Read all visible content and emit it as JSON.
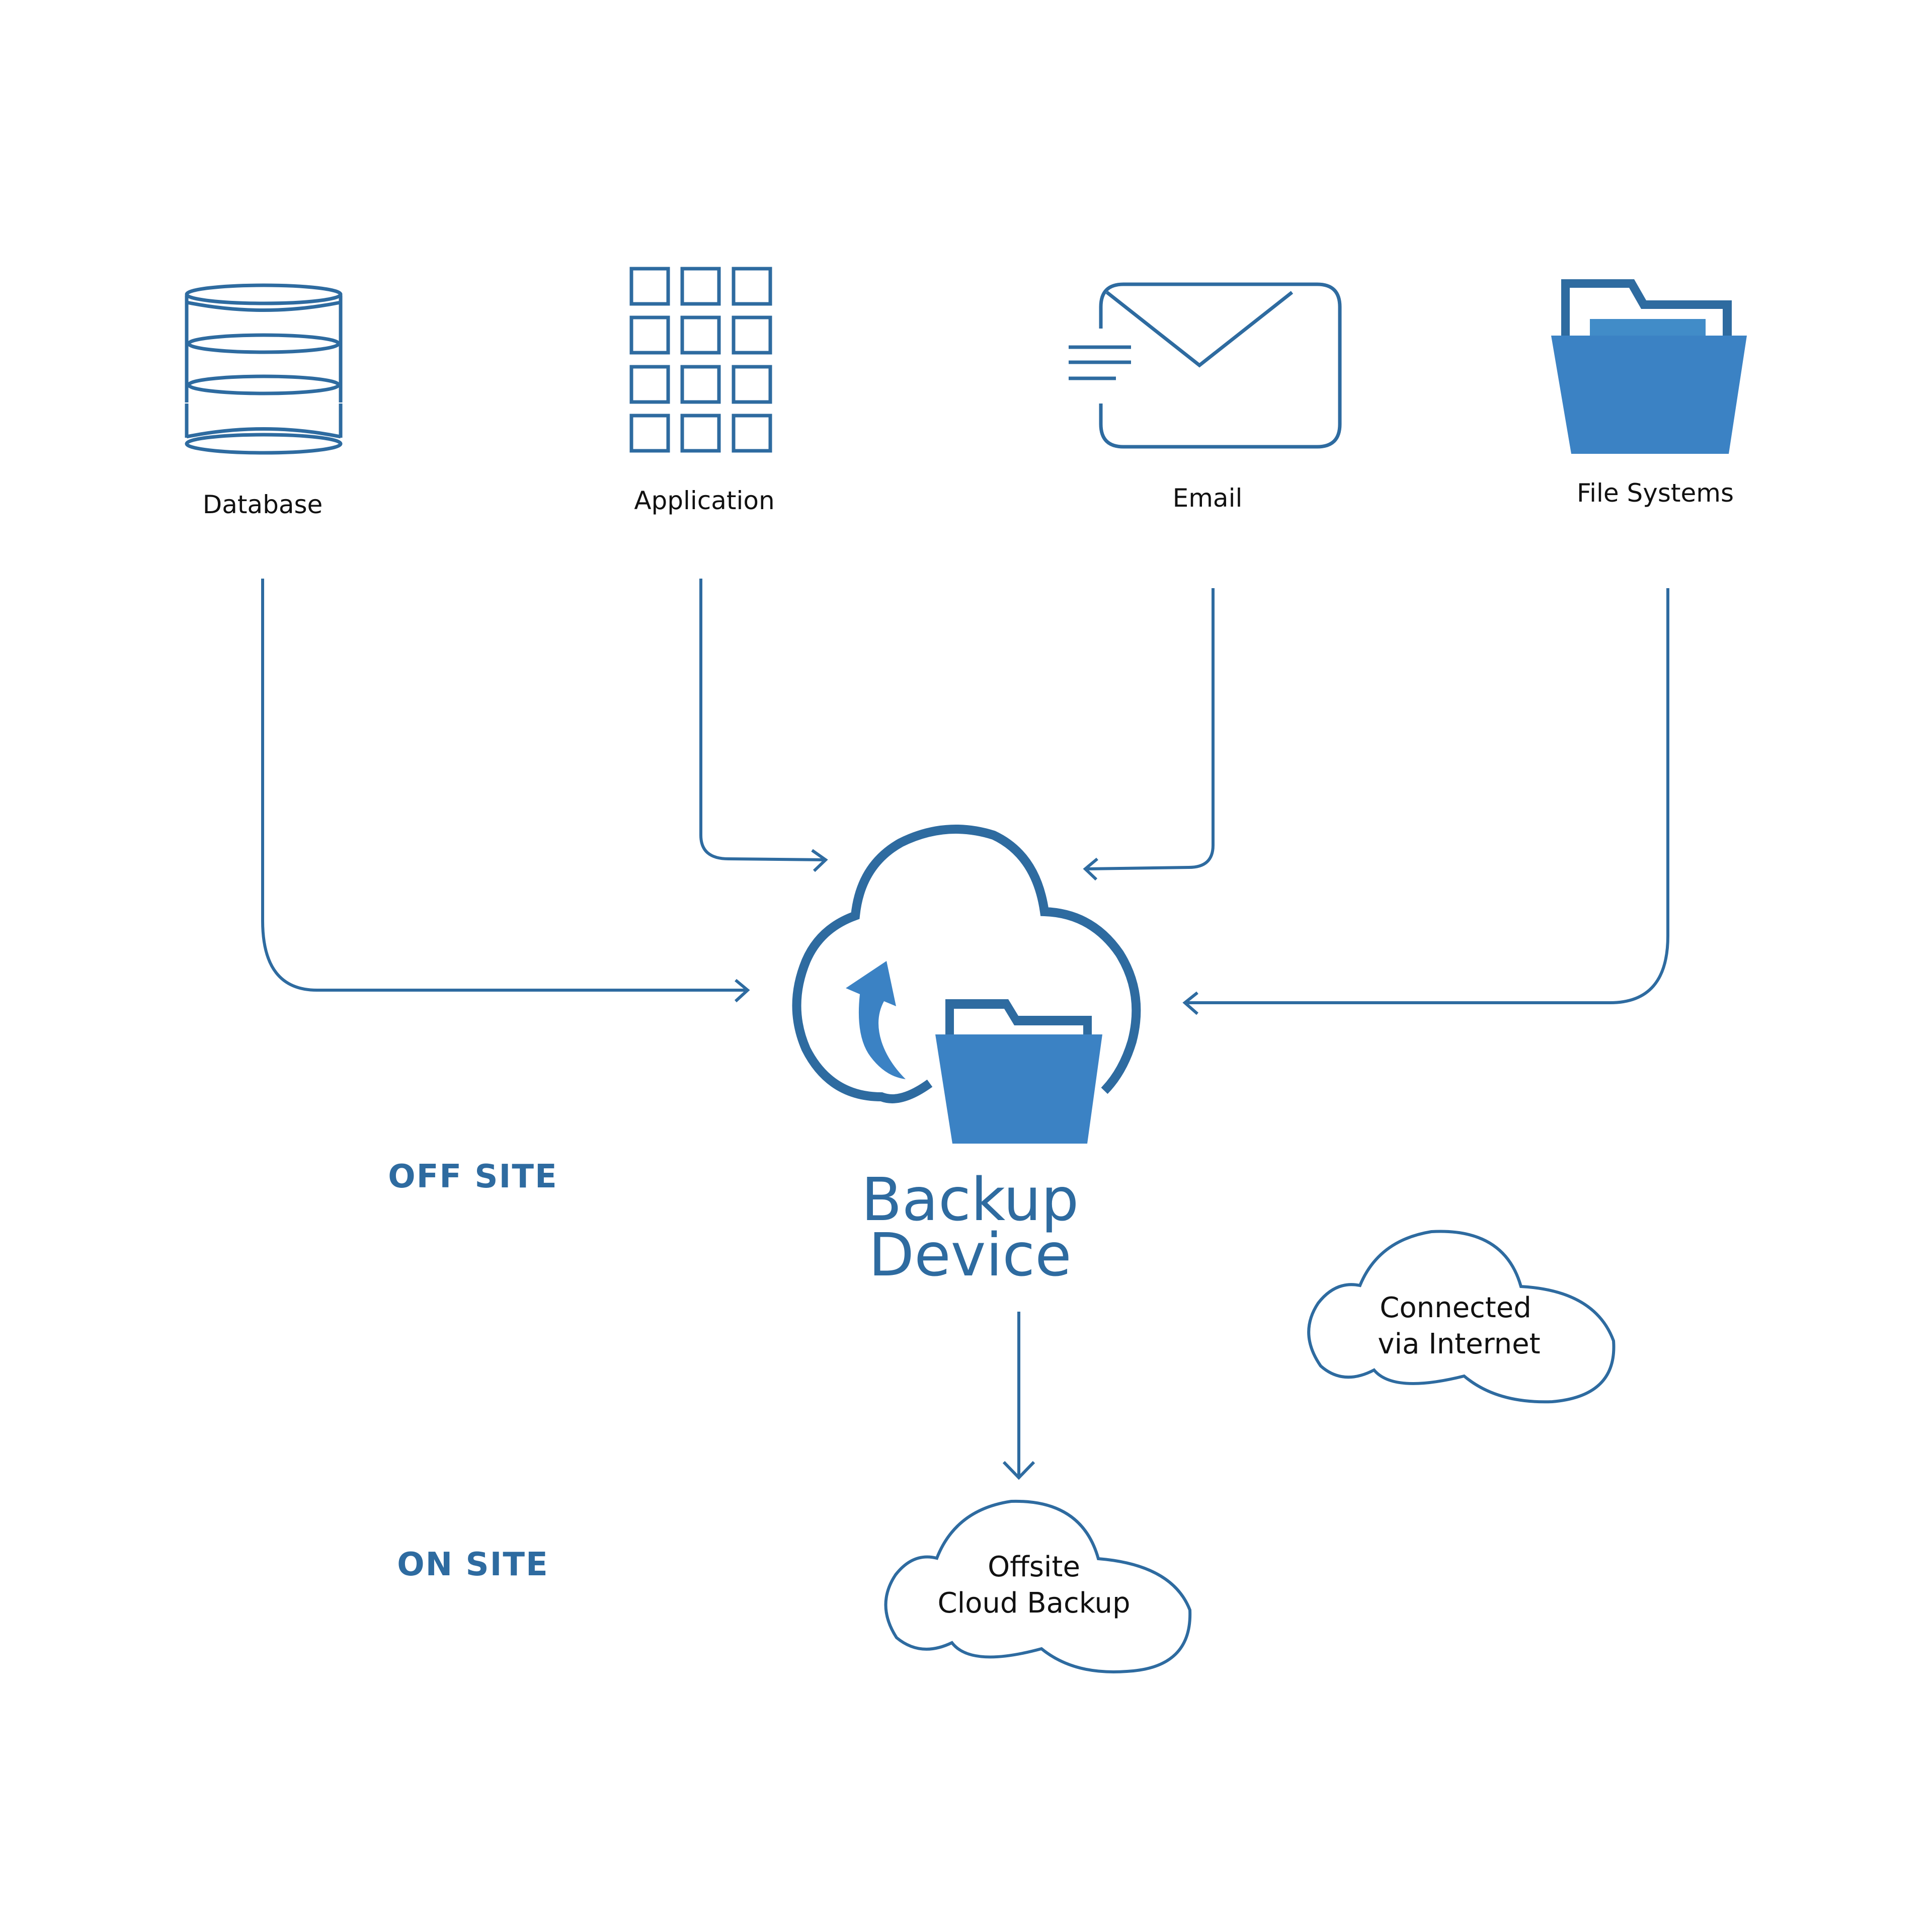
{
  "colors": {
    "outline": "#2E6BA0",
    "fill": "#3B82C4",
    "fill_light": "#418CC8",
    "text": "#111111",
    "background": "#ffffff"
  },
  "sources": [
    {
      "id": "database",
      "label": "Database",
      "icon": "database-icon"
    },
    {
      "id": "application",
      "label": "Application",
      "icon": "application-grid-icon"
    },
    {
      "id": "email",
      "label": "Email",
      "icon": "email-icon"
    },
    {
      "id": "file_systems",
      "label": "File Systems",
      "icon": "folder-icon"
    }
  ],
  "center": {
    "title_line1": "Backup",
    "title_line2": "Device",
    "icon": "cloud-backup-folder-icon"
  },
  "zones": {
    "off_site": "OFF SITE",
    "on_site": "ON SITE"
  },
  "clouds": {
    "internet": {
      "line1": "Connected",
      "line2": "via Internet"
    },
    "offsite": {
      "line1": "Offsite",
      "line2": "Cloud Backup"
    }
  },
  "connections": [
    {
      "from": "Database",
      "to": "Backup Device"
    },
    {
      "from": "Application",
      "to": "Backup Device"
    },
    {
      "from": "Email",
      "to": "Backup Device"
    },
    {
      "from": "File Systems",
      "to": "Backup Device"
    },
    {
      "from": "Backup Device",
      "to": "Offsite Cloud Backup"
    }
  ]
}
